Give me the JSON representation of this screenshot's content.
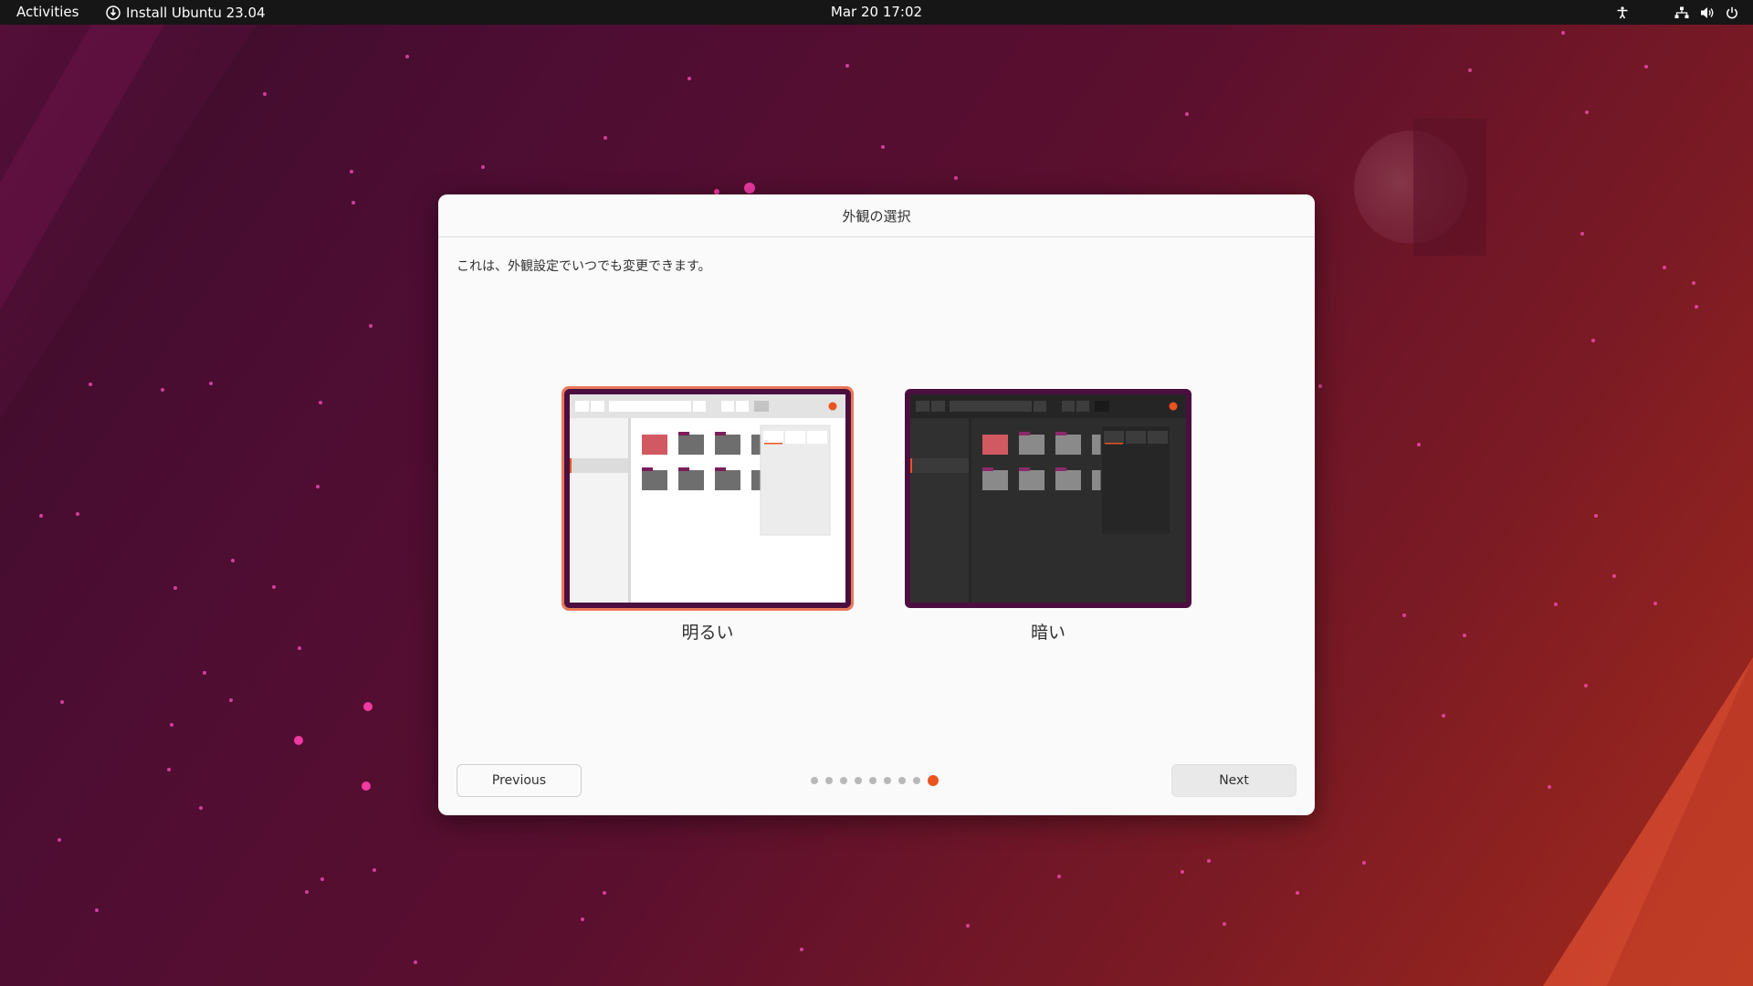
{
  "topbar": {
    "activities_label": "Activities",
    "app_name": "Install Ubuntu 23.04",
    "clock": "Mar 20  17:02",
    "tray_icons": [
      "accessibility-icon",
      "network-icon",
      "volume-icon",
      "power-icon"
    ]
  },
  "dialog": {
    "title": "外観の選択",
    "description": "これは、外観設定でいつでも変更できます。",
    "options": [
      {
        "label": "明るい",
        "selected": true
      },
      {
        "label": "暗い",
        "selected": false
      }
    ],
    "previous_label": "Previous",
    "next_label": "Next",
    "pages": {
      "total": 9,
      "current": 9
    }
  },
  "colors": {
    "accent": "#e95420",
    "selection_border": "#e9785a",
    "topbar_bg": "#161616",
    "dialog_bg": "#fafafa"
  }
}
